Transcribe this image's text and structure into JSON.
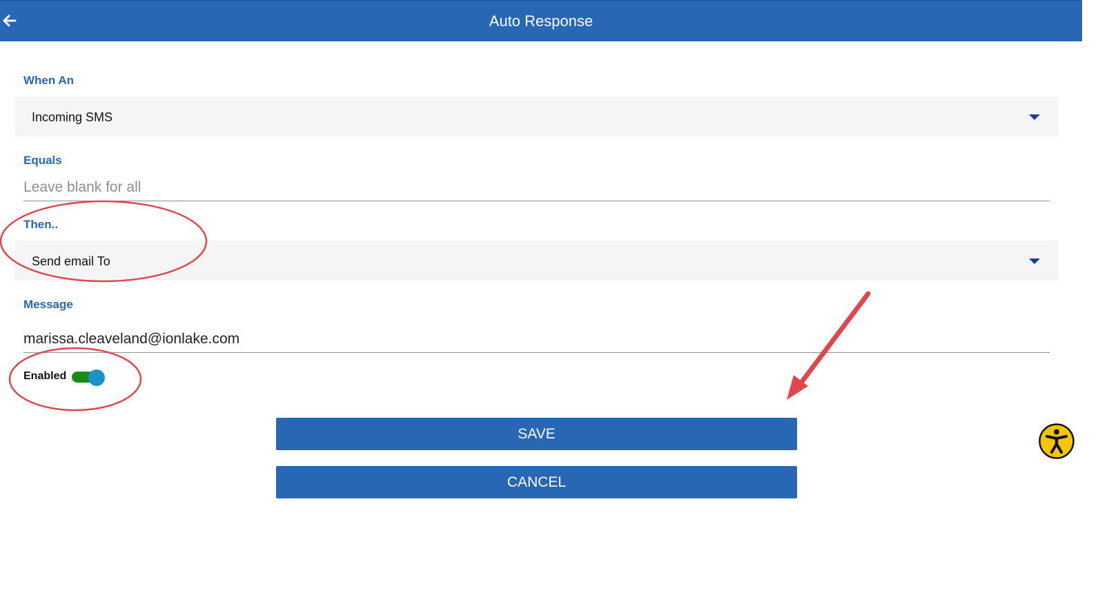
{
  "header": {
    "title": "Auto Response",
    "back_icon": "arrow-left-icon"
  },
  "when_an": {
    "label": "When An",
    "selected": "Incoming SMS"
  },
  "equals": {
    "label": "Equals",
    "placeholder": "Leave blank for all",
    "value": ""
  },
  "then": {
    "label": "Then..",
    "selected": "Send email To"
  },
  "message": {
    "label": "Message",
    "value": "marissa.cleaveland@ionlake.com"
  },
  "enabled": {
    "label": "Enabled",
    "on": true
  },
  "actions": {
    "save_label": "SAVE",
    "cancel_label": "CANCEL"
  },
  "colors": {
    "primary": "#2767b3",
    "toggle_track": "#1b8a1b",
    "toggle_thumb": "#1a94c8",
    "annotation_red": "#e0474c",
    "accessibility_yellow": "#f6c400"
  },
  "icons": {
    "accessibility": "accessibility-icon",
    "dropdown": "chevron-down-icon"
  }
}
